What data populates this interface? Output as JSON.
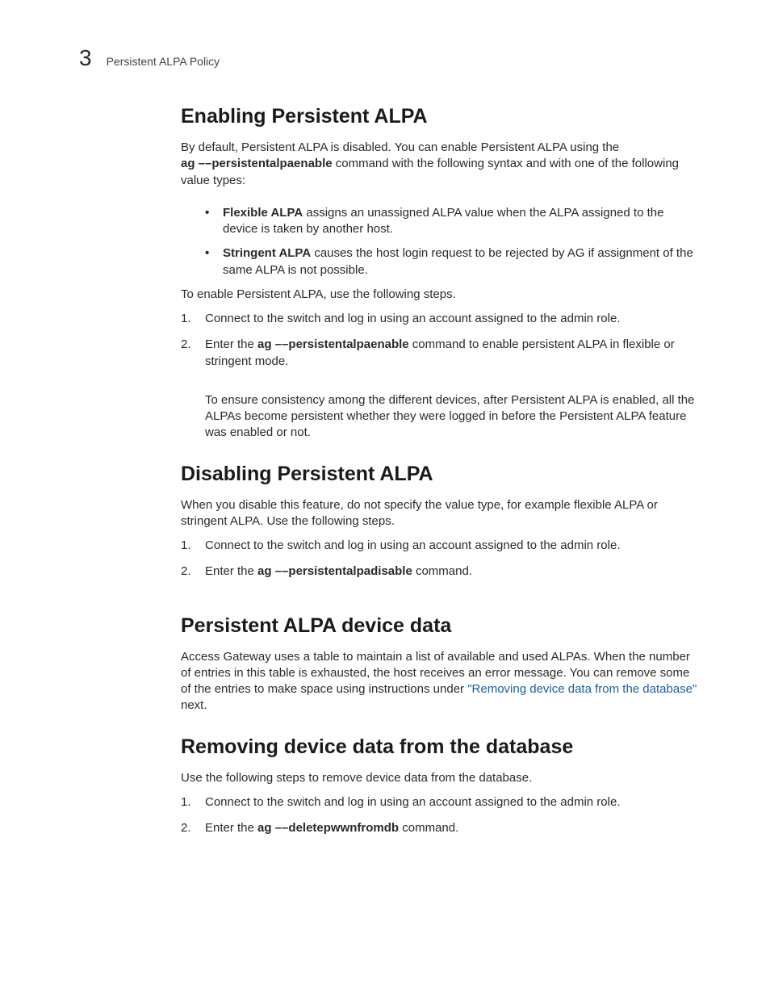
{
  "header": {
    "chapter_number": "3",
    "running_head": "Persistent ALPA Policy"
  },
  "s1": {
    "heading": "Enabling Persistent ALPA",
    "intro_pre": "By default, Persistent ALPA is disabled. You can enable Persistent ALPA using the ",
    "intro_cmd": "ag ––persistentalpaenable",
    "intro_post": " command with the following syntax and with one of the following value types:",
    "bullets": [
      {
        "term": "Flexible ALPA",
        "text": " assigns an unassigned ALPA value when the ALPA assigned to the device is taken by another host."
      },
      {
        "term": "Stringent ALPA",
        "text": " causes the host login request to be rejected by AG if assignment of the same ALPA is not possible."
      }
    ],
    "pre_steps": "To enable Persistent ALPA, use the following steps.",
    "steps": {
      "step1": "Connect to the switch and log in using an account assigned to the admin role.",
      "step2_pre": "Enter the ",
      "step2_cmd": "ag ––persistentalpaenable",
      "step2_post": " command to enable persistent ALPA in flexible or stringent mode."
    },
    "note": "To ensure consistency among the different devices, after Persistent ALPA is enabled, all the ALPAs become persistent whether they were logged in before the Persistent ALPA feature was enabled or not."
  },
  "s2": {
    "heading": "Disabling Persistent ALPA",
    "intro": "When you disable this feature, do not specify the value type, for example flexible ALPA or stringent ALPA. Use the following steps.",
    "steps": {
      "step1": "Connect to the switch and log in using an account assigned to the admin role.",
      "step2_pre": "Enter the ",
      "step2_cmd": "ag ––persistentalpadisable",
      "step2_post": " command."
    }
  },
  "s3": {
    "heading": "Persistent ALPA device data",
    "body_pre": "Access Gateway uses a table to maintain a list of available and used ALPAs. When the number of entries in this table is exhausted, the host receives an error message. You can remove some of the entries to make space using instructions under ",
    "link_text": "\"Removing device data from the database\"",
    "body_post": " next."
  },
  "s4": {
    "heading": "Removing device data from the database",
    "intro": "Use the following steps to remove device data from the database.",
    "steps": {
      "step1": "Connect to the switch and log in using an account assigned to the admin role.",
      "step2_pre": "Enter the ",
      "step2_cmd": "ag ––deletepwwnfromdb",
      "step2_post": " command."
    }
  }
}
